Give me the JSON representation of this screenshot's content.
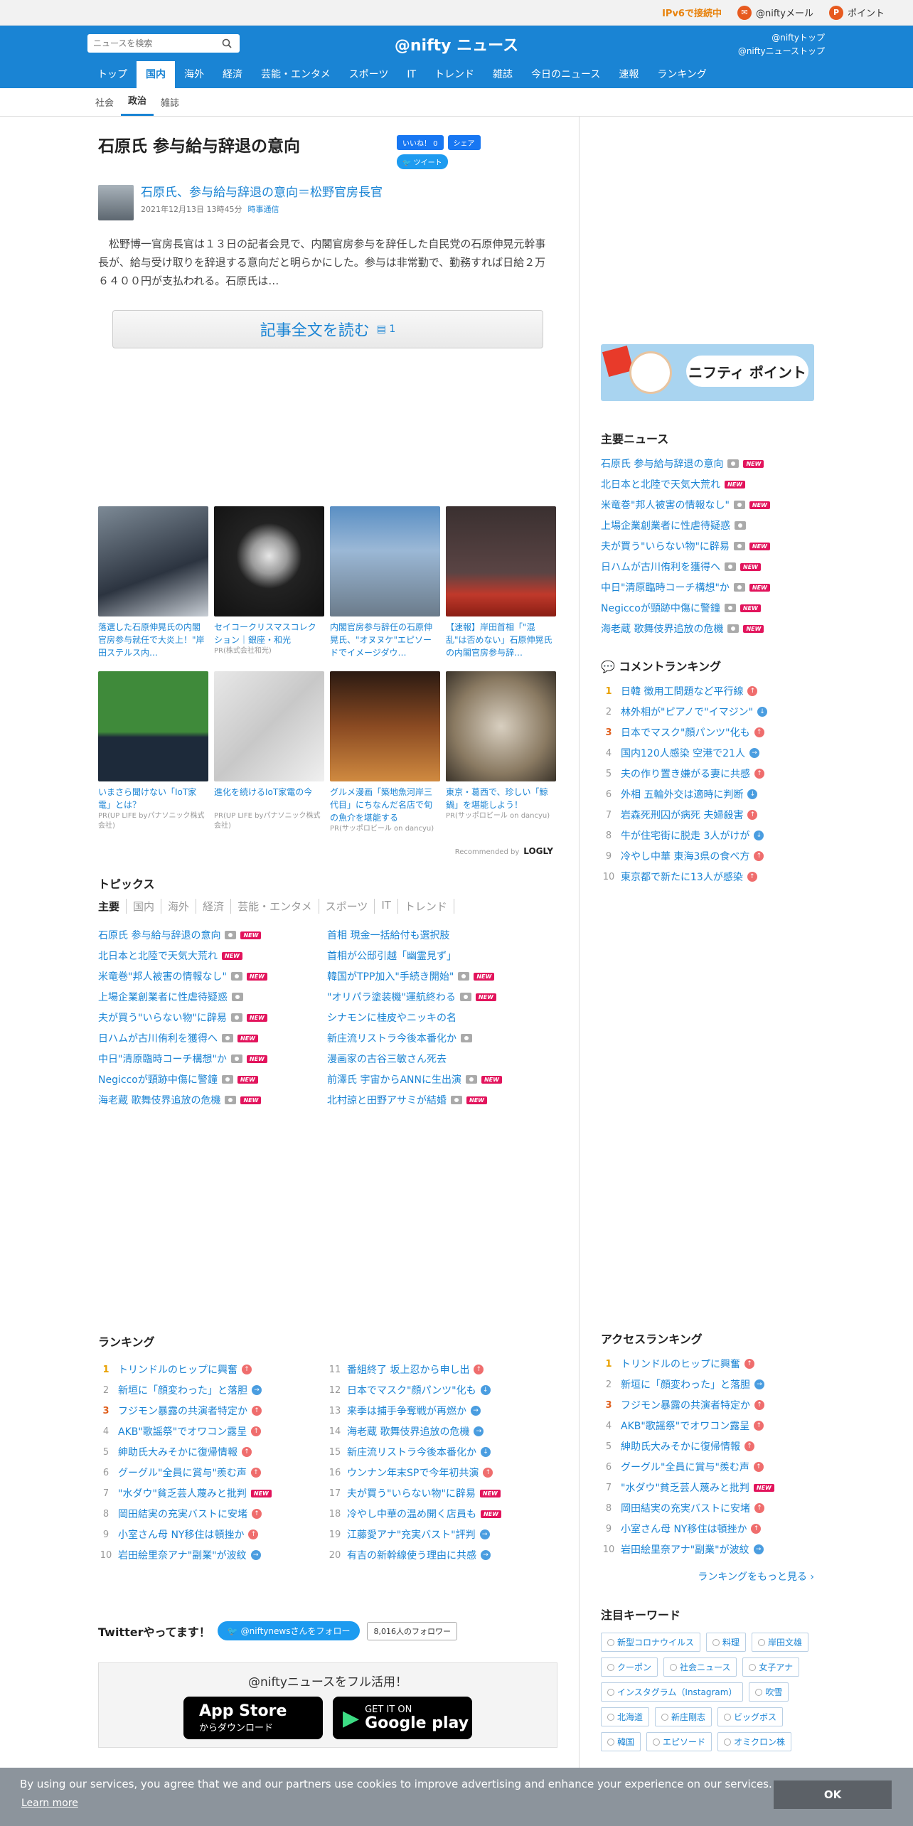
{
  "topbar": {
    "ipv6": "IPv6で接続中",
    "mail": "@niftyメール",
    "point": "ポイント"
  },
  "header": {
    "search_placeholder": "ニュースを検索",
    "logo": "@nifty ニュース",
    "link1": "@niftyトップ",
    "link2": "@niftyニューストップ"
  },
  "gnav": [
    "トップ",
    "国内",
    "海外",
    "経済",
    "芸能・エンタメ",
    "スポーツ",
    "IT",
    "トレンド",
    "雑誌",
    "今日のニュース",
    "速報",
    "ランキング"
  ],
  "subnav": [
    "社会",
    "政治",
    "雑誌"
  ],
  "article": {
    "title": "石原氏 参与給与辞退の意向",
    "like": "いいね！ 0",
    "share": "シェア",
    "tweet": "ツイート",
    "headline": "石原氏、参与給与辞退の意向＝松野官房長官",
    "date": "2021年12月13日 13時45分",
    "source": "時事通信",
    "lead": "松野博一官房長官は１３日の記者会見で、内閣官房参与を辞任した自民党の石原伸晃元幹事長が、給与受け取りを辞退する意向だと明らかにした。参与は非常勤で、勤務すれば日給２万６４００円が支払われる。石原氏は…",
    "read": "記事全文を読む",
    "read_count": "1"
  },
  "cards_row1": [
    {
      "text": "落選した石原伸晃氏の内閣官房参与就任で大炎上！\"岸田ステルス内…",
      "pr": ""
    },
    {
      "text": "セイコークリスマスコレクション｜銀座・和光",
      "pr": "PR(株式会社和光)"
    },
    {
      "text": "内閣官房参与辞任の石原伸晃氏、\"オヌヌケ\"エピソードでイメージダウ…",
      "pr": ""
    },
    {
      "text": "【速報】岸田首相「\"混乱\"は否めない」石原伸晃氏の内閣官房参与辞…",
      "pr": ""
    }
  ],
  "cards_row2": [
    {
      "text": "いまさら聞けない「IoT家電」とは？",
      "pr": "PR(UP LIFE byパナソニック株式会社)"
    },
    {
      "text": "進化を続けるIoT家電の今",
      "pr": "PR(UP LIFE byパナソニック株式会社)"
    },
    {
      "text": "グルメ漫画「築地魚河岸三代目」にちなんだ名店で旬の魚介を堪能する",
      "pr": "PR(サッポロビール on dancyu)"
    },
    {
      "text": "東京・葛西で、珍しい「鯨鍋」を堪能しよう！",
      "pr": "PR(サッポロビール on dancyu)"
    }
  ],
  "reco": {
    "label": "Recommended by",
    "brand": "LOGLY"
  },
  "topics": {
    "title": "トピックス",
    "tabs": [
      "主要",
      "国内",
      "海外",
      "経済",
      "芸能・エンタメ",
      "スポーツ",
      "IT",
      "トレンド"
    ],
    "items": [
      "石原氏 参与給与辞退の意向",
      "首相 現金一括給付も選択肢",
      "北日本と北陸で天気大荒れ",
      "首相が公邸引越「幽霊見ず」",
      "米竜巻\"邦人被害の情報なし\"",
      "韓国がTPP加入\"手続き開始\"",
      "上場企業創業者に性虐待疑惑",
      "\"オリパラ塗装機\"運航終わる",
      "夫が買う\"いらない物\"に辟易",
      "シナモンに桂皮やニッキの名",
      "日ハムが古川侑利を獲得へ",
      "新庄流リストラ今後本番化か",
      "中日\"清原臨時コーチ構想\"か",
      "漫画家の古谷三敏さん死去",
      "Negiccoが頸跡中傷に警鐘",
      "前澤氏 宇宙からANNに生出演",
      "海老蔵 歌舞伎界追放の危機",
      "北村諒と田野アサミが結婚"
    ]
  },
  "ranking": {
    "title": "ランキング",
    "items": [
      "トリンドルのヒップに興奮",
      "番組終了 坂上忍から申し出",
      "新垣に「顔変わった」と落胆",
      "日本でマスク\"顔パンツ\"化も",
      "フジモン暴露の共演者特定か",
      "来季は捕手争奪戦が再燃か",
      "AKB\"歌謡祭\"でオワコン露呈",
      "海老蔵 歌舞伎界追放の危機",
      "紳助氏大みそかに復帰情報",
      "新庄流リストラ今後本番化か",
      "グーグル\"全員に賞与\"羨む声",
      "ウンナン年末SPで今年初共演",
      "\"水ダウ\"貧乏芸人蔑みと批判",
      "夫が買う\"いらない物\"に辟易",
      "岡田結実の充実バストに安堵",
      "冷やし中華の温め開く店員も",
      "小室さん母 NY移住は頓挫か",
      "江藤愛アナ\"充実バスト\"評判",
      "岩田絵里奈アナ\"副業\"が波紋",
      "有吉の新幹線使う理由に共感"
    ],
    "nums": [
      "1",
      "11",
      "2",
      "12",
      "3",
      "13",
      "4",
      "14",
      "5",
      "15",
      "6",
      "16",
      "7",
      "17",
      "8",
      "18",
      "9",
      "19",
      "10",
      "20"
    ]
  },
  "twitter": {
    "title": "Twitterやってます！",
    "follow": "@niftynewsさんをフォロー",
    "count": "8,016人のフォロワー"
  },
  "app": {
    "title": "@niftyニュースをフル活用！",
    "appstore1": "App Store",
    "appstore2": "からダウンロード",
    "gp1": "GET IT ON",
    "gp2": "Google play"
  },
  "side": {
    "point": "ニフティ ポイント",
    "main_title": "主要ニュース",
    "main": [
      "石原氏 参与給与辞退の意向",
      "北日本と北陸で天気大荒れ",
      "米竜巻\"邦人被害の情報なし\"",
      "上場企業創業者に性虐待疑惑",
      "夫が買う\"いらない物\"に辟易",
      "日ハムが古川侑利を獲得へ",
      "中日\"清原臨時コーチ構想\"か",
      "Negiccoが頸跡中傷に警鐘",
      "海老蔵 歌舞伎界追放の危機"
    ],
    "comment_title": "コメントランキング",
    "comment": [
      "日韓 徴用工問題など平行線",
      "林外相が\"ピアノで\"イマジン\"",
      "日本でマスク\"顔パンツ\"化も",
      "国内120人感染 空港で21人",
      "夫の作り置き嫌がる妻に共感",
      "外相 五輪外交は適時に判断",
      "岩森死刑囚が病死 夫婦殺害",
      "牛が住宅街に脱走 3人がけが",
      "冷やし中華 東海3県の食べ方",
      "東京都で新たに13人が感染"
    ],
    "access_title": "アクセスランキング",
    "access": [
      "トリンドルのヒップに興奮",
      "新垣に「顔変わった」と落胆",
      "フジモン暴露の共演者特定か",
      "AKB\"歌謡祭\"でオワコン露呈",
      "紳助氏大みそかに復帰情報",
      "グーグル\"全員に賞与\"羨む声",
      "\"水ダウ\"貧乏芸人蔑みと批判",
      "岡田結実の充実バストに安堵",
      "小室さん母 NY移住は頓挫か",
      "岩田絵里奈アナ\"副業\"が波紋"
    ],
    "more": "ランキングをもっと見る ›",
    "kw_title": "注目キーワード",
    "keywords": [
      "新型コロナウイルス",
      "料理",
      "岸田文雄",
      "クーポン",
      "社会ニュース",
      "女子アナ",
      "インスタグラム（Instagram）",
      "吹雪",
      "北海道",
      "新庄剛志",
      "ビッグボス",
      "韓国",
      "エピソード",
      "オミクロン株"
    ]
  },
  "cookie": {
    "msg": "By using our services, you agree that we and our partners use cookies to improve advertising and enhance your experience on our services.",
    "learn": "Learn more",
    "ok": "OK"
  }
}
